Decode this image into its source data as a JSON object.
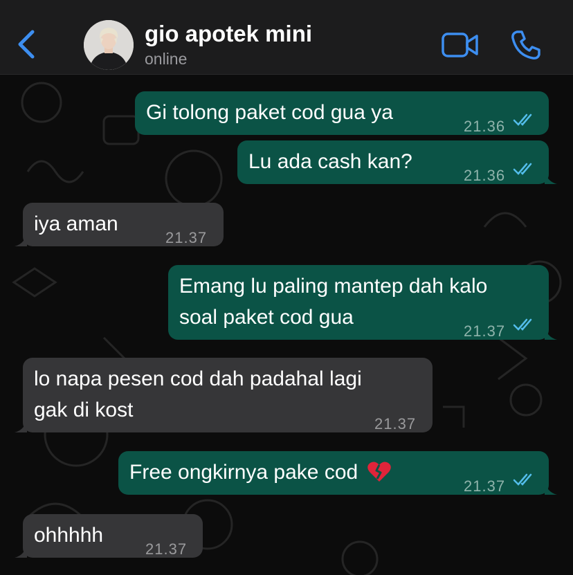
{
  "header": {
    "contact_name": "gio apotek mini",
    "status": "online"
  },
  "messages": [
    {
      "direction": "out",
      "lines": [
        "Gi tolong paket cod gua ya"
      ],
      "time": "21.36",
      "read": true
    },
    {
      "direction": "out",
      "lines": [
        "Lu ada cash kan?"
      ],
      "time": "21.36",
      "read": true
    },
    {
      "direction": "in",
      "lines": [
        "iya aman"
      ],
      "time": "21.37"
    },
    {
      "direction": "out",
      "lines": [
        "Emang lu paling mantep dah kalo",
        "soal paket cod gua"
      ],
      "time": "21.37",
      "read": true
    },
    {
      "direction": "in",
      "lines": [
        "lo napa pesen cod dah padahal lagi",
        "gak di kost"
      ],
      "time": "21.37"
    },
    {
      "direction": "out",
      "lines": [
        "Free ongkirnya pake cod"
      ],
      "emoji": "broken-heart-icon",
      "time": "21.37",
      "read": true
    },
    {
      "direction": "in",
      "lines": [
        "ohhhhh"
      ],
      "time": "21.37"
    }
  ],
  "colors": {
    "header_bg": "#1c1c1d",
    "accent": "#3d8ef0",
    "outgoing_bubble": "#0b5346",
    "incoming_bubble": "#363638",
    "read_ticks": "#53bdeb"
  }
}
